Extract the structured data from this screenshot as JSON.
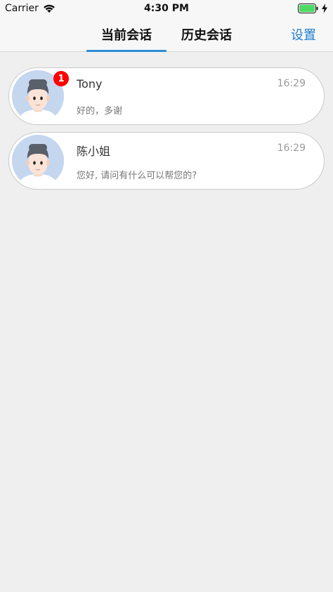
{
  "status_bar": {
    "carrier": "Carrier",
    "time": "4:30 PM"
  },
  "nav": {
    "tabs": [
      {
        "label": "当前会话",
        "active": true
      },
      {
        "label": "历史会话",
        "active": false
      }
    ],
    "settings_label": "设置",
    "accent_color": "#2f8dd5"
  },
  "conversations": [
    {
      "name": "Tony",
      "time": "16:29",
      "preview": "好的，多谢",
      "unread": "1",
      "avatar": "person-avatar"
    },
    {
      "name": "陈小姐",
      "time": "16:29",
      "preview": "您好, 请问有什么可以帮您的?",
      "avatar": "person-avatar"
    }
  ]
}
